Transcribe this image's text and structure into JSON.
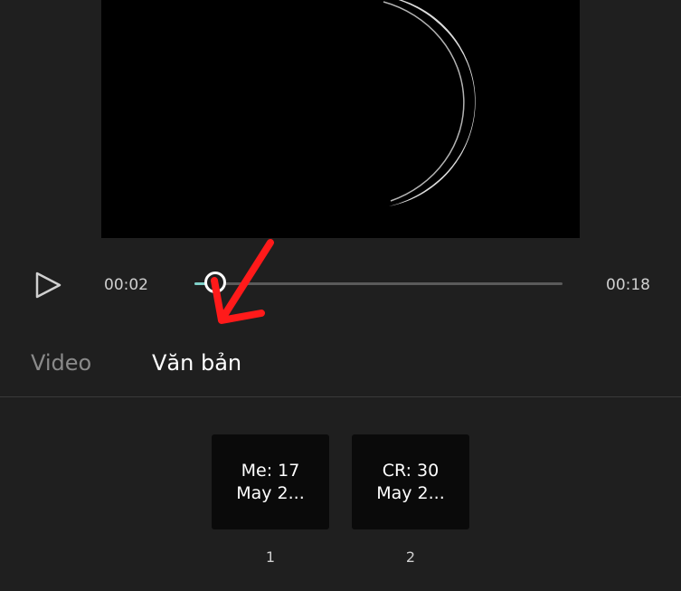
{
  "player": {
    "current_time": "00:02",
    "total_time": "00:18",
    "progress_fraction": 0.056
  },
  "tabs": [
    {
      "label": "Video",
      "active": false
    },
    {
      "label": "Văn bản",
      "active": true
    }
  ],
  "text_items": [
    {
      "line1": "Me: 17",
      "line2": "May 2...",
      "index": "1"
    },
    {
      "line1": "CR: 30",
      "line2": "May 2...",
      "index": "2"
    }
  ],
  "colors": {
    "background": "#1f1f1f",
    "progress": "#7fd0c8",
    "annotation": "#ff1a1a"
  },
  "icons": {
    "play": "play-icon",
    "annotation": "red-arrow-icon"
  }
}
